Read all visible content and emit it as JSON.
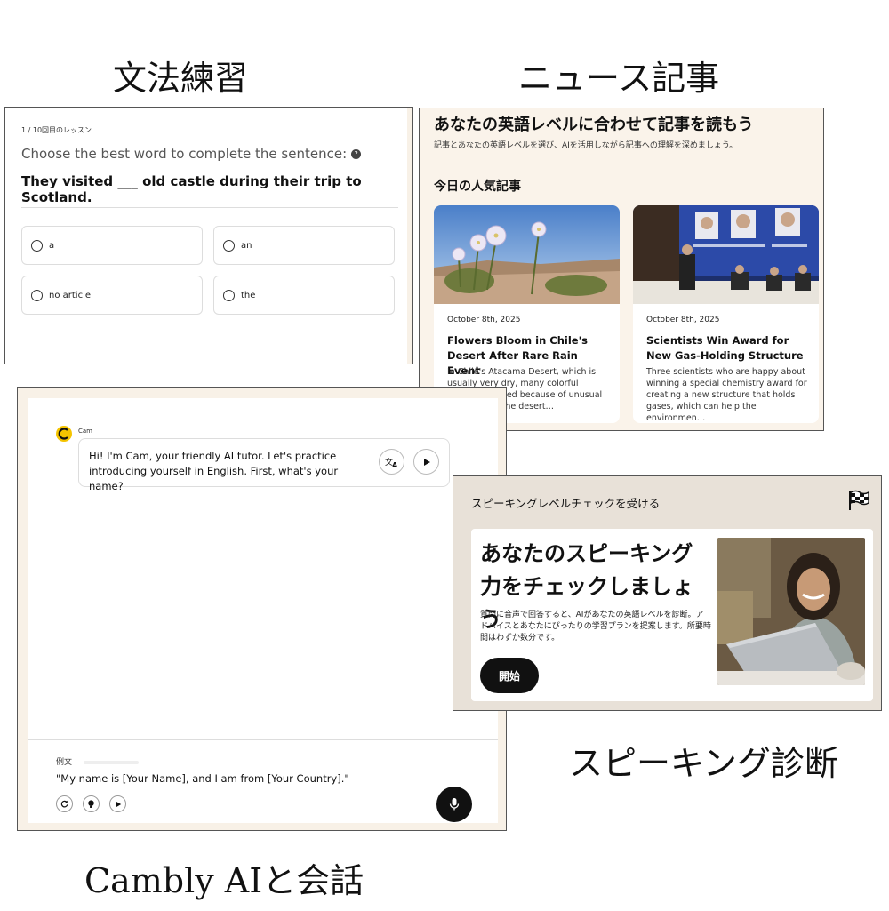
{
  "captions": {
    "grammar": "文法練習",
    "news": "ニュース記事",
    "chat": "Cambly AIと会話",
    "speaking": "スピーキング診断"
  },
  "grammar": {
    "progress": "1 / 10回目のレッスン",
    "prompt": "Choose the best word to complete the sentence:",
    "help_icon": "?",
    "sentence": "They visited ___ old castle during their trip to Scotland.",
    "options": [
      "a",
      "an",
      "no article",
      "the"
    ]
  },
  "news": {
    "title": "あなたの英語レベルに合わせて記事を読もう",
    "subtitle": "記事とあなたの英語レベルを選び、AIを活用しながら記事への理解を深めましょう。",
    "section": "今日の人気記事",
    "articles": [
      {
        "date": "October 8th, 2025",
        "headline": "Flowers Bloom in Chile's Desert After Rare Rain Event",
        "desc": "In Chile's Atacama Desert, which is usually very dry, many colorful flowers bloomed because of unusual rain, turning the desert…"
      },
      {
        "date": "October 8th, 2025",
        "headline": "Scientists Win Award for New Gas-Holding Structure",
        "desc": "Three scientists who are happy about winning a special chemistry award for creating a new structure that holds gases, which can help the environmen…"
      }
    ]
  },
  "chat": {
    "tutor_name": "Cam",
    "message": "Hi! I'm Cam, your friendly AI tutor. Let's practice introducing yourself in English. First, what's your name?",
    "example_label": "例文",
    "example_text": "\"My name is [Your Name], and I am from [Your Country].\""
  },
  "speaking": {
    "header": "スピーキングレベルチェックを受ける",
    "title": "あなたのスピーキング力をチェックしましょう",
    "description": "質問に音声で回答すると、AIがあなたの英語レベルを診断。アドバイスとあなたにぴったりの学習プランを提案します。所要時間はわずか数分です。",
    "start_button": "開始"
  },
  "icons": {
    "help": "help-circle-icon",
    "translate": "translate-icon",
    "play": "play-icon",
    "replay": "replay-icon",
    "hint": "hint-bulb-icon",
    "mic": "microphone-icon",
    "flag": "checkered-flag-icon"
  }
}
